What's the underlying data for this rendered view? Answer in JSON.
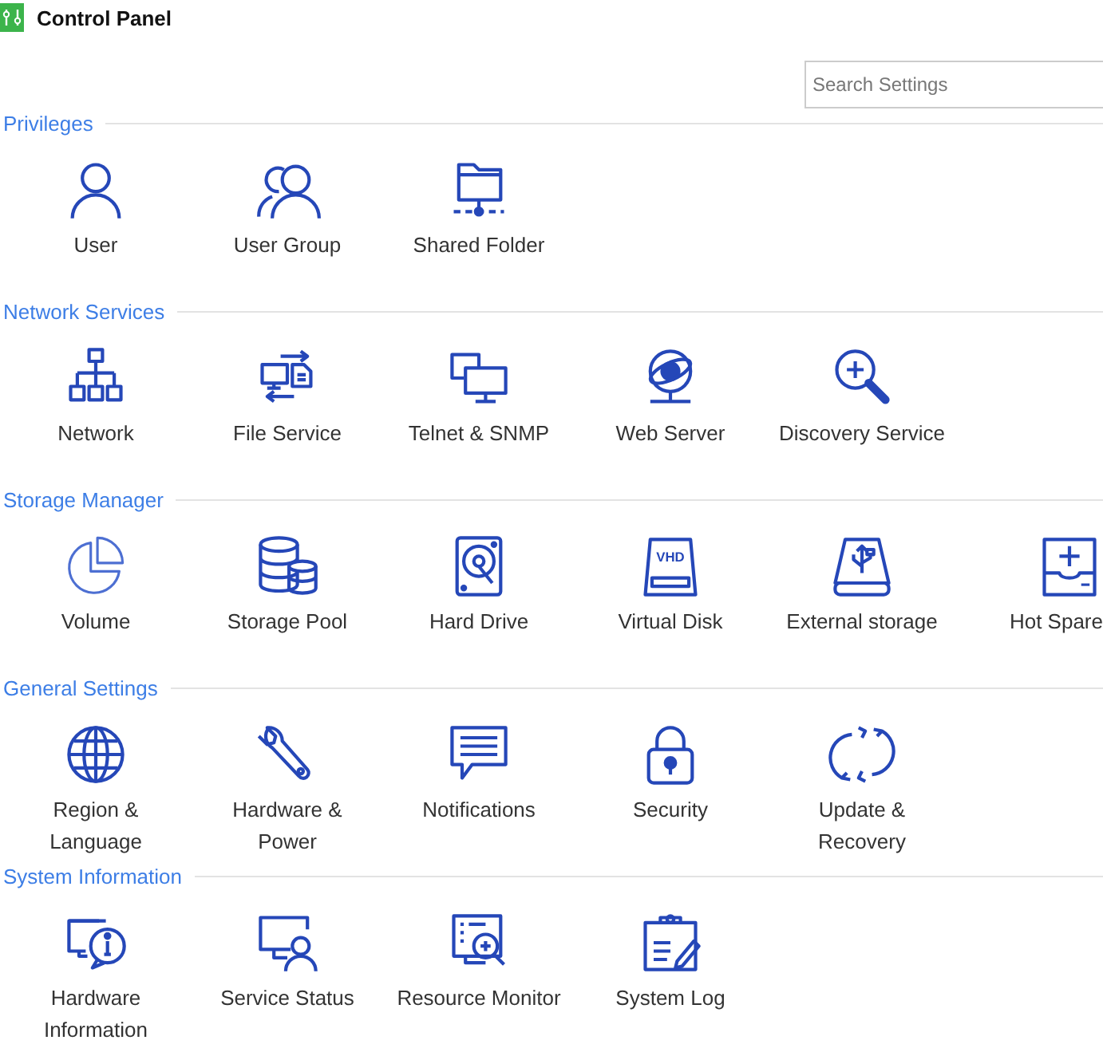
{
  "window": {
    "title": "Control Panel"
  },
  "search": {
    "placeholder": "Search Settings"
  },
  "sections": [
    {
      "title": "Privileges",
      "items": [
        {
          "label": "User"
        },
        {
          "label": "User Group"
        },
        {
          "label": "Shared Folder"
        }
      ]
    },
    {
      "title": "Network Services",
      "items": [
        {
          "label": "Network"
        },
        {
          "label": "File Service"
        },
        {
          "label": "Telnet & SNMP"
        },
        {
          "label": "Web Server"
        },
        {
          "label": "Discovery Service"
        }
      ]
    },
    {
      "title": "Storage Manager",
      "items": [
        {
          "label": "Volume"
        },
        {
          "label": "Storage Pool"
        },
        {
          "label": "Hard Drive"
        },
        {
          "label": "Virtual Disk",
          "icon_text": "VHD"
        },
        {
          "label": "External storage"
        },
        {
          "label": "Hot Spare"
        }
      ]
    },
    {
      "title": "General Settings",
      "items": [
        {
          "label": "Region &\nLanguage"
        },
        {
          "label": "Hardware &\nPower"
        },
        {
          "label": "Notifications"
        },
        {
          "label": "Security"
        },
        {
          "label": "Update &\nRecovery"
        }
      ]
    },
    {
      "title": "System Information",
      "items": [
        {
          "label": "Hardware\nInformation"
        },
        {
          "label": "Service Status"
        },
        {
          "label": "Resource Monitor"
        },
        {
          "label": "System Log"
        }
      ]
    }
  ]
}
